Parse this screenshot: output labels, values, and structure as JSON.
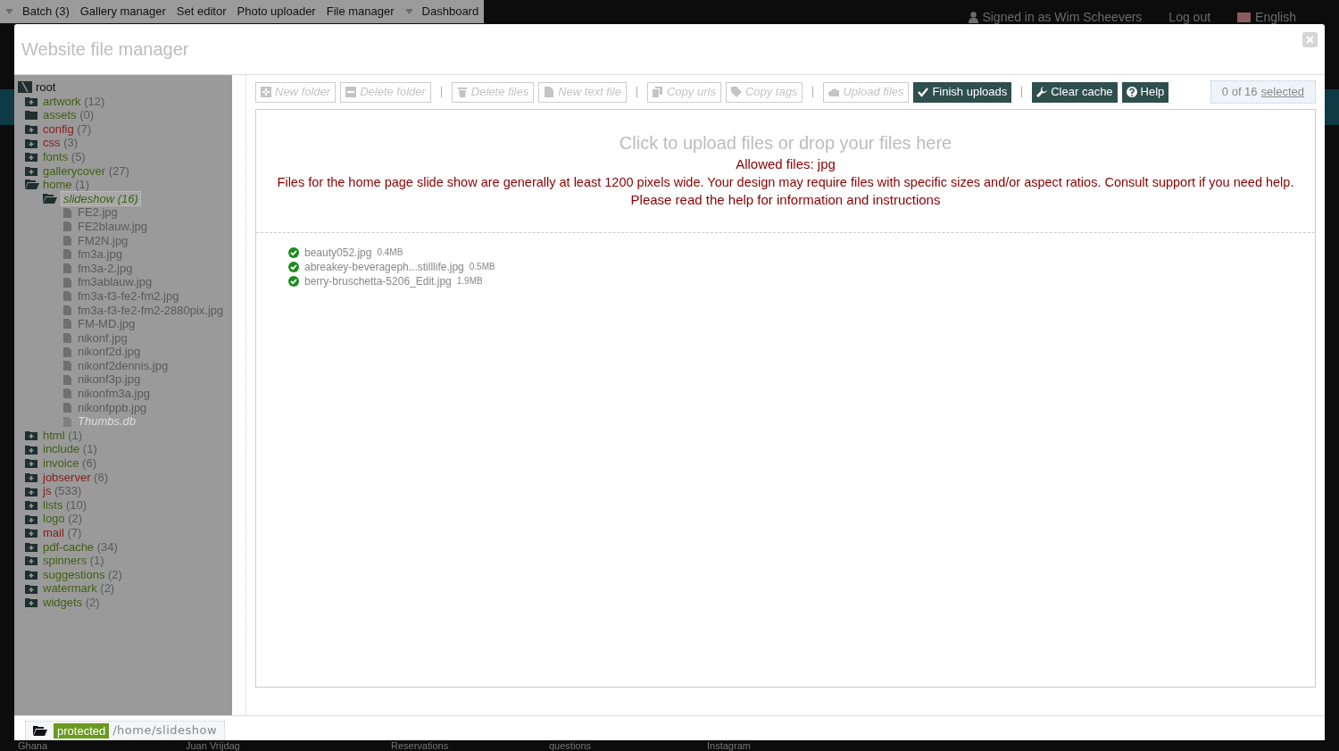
{
  "top_menu": [
    {
      "label": "Batch (3)",
      "caret": true
    },
    {
      "label": "Gallery manager",
      "caret": false
    },
    {
      "label": "Set editor",
      "caret": false
    },
    {
      "label": "Photo uploader",
      "caret": false
    },
    {
      "label": "File manager",
      "caret": false
    },
    {
      "label": "Dashboard",
      "caret": true
    }
  ],
  "user_bar": {
    "signed_in": "Signed in as Wim Scheevers",
    "logout": "Log out",
    "language": "English"
  },
  "window": {
    "title": "Website file manager"
  },
  "tree": {
    "root": "root",
    "children": [
      {
        "kind": "folder",
        "name": "artwork",
        "count": "(12)",
        "color": "#3f5f12",
        "expanded": false,
        "selected": false
      },
      {
        "kind": "folder",
        "name": "assets",
        "count": "(0)",
        "color": "#3f5f12",
        "expanded": false,
        "selected": false,
        "empty": true
      },
      {
        "kind": "folder",
        "name": "config",
        "count": "(7)",
        "color": "#8b1a1a",
        "expanded": false,
        "selected": false
      },
      {
        "kind": "folder",
        "name": "css",
        "count": "(3)",
        "color": "#8b1a1a",
        "expanded": false,
        "selected": false
      },
      {
        "kind": "folder",
        "name": "fonts",
        "count": "(5)",
        "color": "#3f5f12",
        "expanded": false,
        "selected": false
      },
      {
        "kind": "folder",
        "name": "gallerycover",
        "count": "(27)",
        "color": "#3f5f12",
        "expanded": false,
        "selected": false
      },
      {
        "kind": "folder",
        "name": "home",
        "count": "(1)",
        "color": "#3f5f12",
        "expanded": true,
        "selected": false,
        "children": [
          {
            "kind": "folder",
            "name": "slideshow",
            "count": "(16)",
            "color": "#3f5f12",
            "expanded": true,
            "selected": true,
            "children": [
              {
                "kind": "file",
                "name": "FE2.jpg",
                "hidden": false
              },
              {
                "kind": "file",
                "name": "FE2blauw.jpg",
                "hidden": false
              },
              {
                "kind": "file",
                "name": "FM2N.jpg",
                "hidden": false
              },
              {
                "kind": "file",
                "name": "fm3a.jpg",
                "hidden": false
              },
              {
                "kind": "file",
                "name": "fm3a-2.jpg",
                "hidden": false
              },
              {
                "kind": "file",
                "name": "fm3ablauw.jpg",
                "hidden": false
              },
              {
                "kind": "file",
                "name": "fm3a-f3-fe2-fm2.jpg",
                "hidden": false
              },
              {
                "kind": "file",
                "name": "fm3a-f3-fe2-fm2-2880pix.jpg",
                "hidden": false
              },
              {
                "kind": "file",
                "name": "FM-MD.jpg",
                "hidden": false
              },
              {
                "kind": "file",
                "name": "nikonf.jpg",
                "hidden": false
              },
              {
                "kind": "file",
                "name": "nikonf2d.jpg",
                "hidden": false
              },
              {
                "kind": "file",
                "name": "nikonf2dennis.jpg",
                "hidden": false
              },
              {
                "kind": "file",
                "name": "nikonf3p.jpg",
                "hidden": false
              },
              {
                "kind": "file",
                "name": "nikonfm3a.jpg",
                "hidden": false
              },
              {
                "kind": "file",
                "name": "nikonfppb.jpg",
                "hidden": false
              },
              {
                "kind": "file",
                "name": "Thumbs.db",
                "hidden": true
              }
            ]
          }
        ]
      },
      {
        "kind": "folder",
        "name": "html",
        "count": "(1)",
        "color": "#3f5f12",
        "expanded": false,
        "selected": false
      },
      {
        "kind": "folder",
        "name": "include",
        "count": "(1)",
        "color": "#3f5f12",
        "expanded": false,
        "selected": false
      },
      {
        "kind": "folder",
        "name": "invoice",
        "count": "(6)",
        "color": "#3f5f12",
        "expanded": false,
        "selected": false
      },
      {
        "kind": "folder",
        "name": "jobserver",
        "count": "(6)",
        "color": "#8b1a1a",
        "expanded": false,
        "selected": false
      },
      {
        "kind": "folder",
        "name": "js",
        "count": "(533)",
        "color": "#8b1a1a",
        "expanded": false,
        "selected": false
      },
      {
        "kind": "folder",
        "name": "lists",
        "count": "(10)",
        "color": "#3f5f12",
        "expanded": false,
        "selected": false
      },
      {
        "kind": "folder",
        "name": "logo",
        "count": "(2)",
        "color": "#3f5f12",
        "expanded": false,
        "selected": false
      },
      {
        "kind": "folder",
        "name": "mail",
        "count": "(7)",
        "color": "#8b1a1a",
        "expanded": false,
        "selected": false
      },
      {
        "kind": "folder",
        "name": "pdf-cache",
        "count": "(34)",
        "color": "#3f5f12",
        "expanded": false,
        "selected": false
      },
      {
        "kind": "folder",
        "name": "spinners",
        "count": "(1)",
        "color": "#3f5f12",
        "expanded": false,
        "selected": false
      },
      {
        "kind": "folder",
        "name": "suggestions",
        "count": "(2)",
        "color": "#3f5f12",
        "expanded": false,
        "selected": false
      },
      {
        "kind": "folder",
        "name": "watermark",
        "count": "(2)",
        "color": "#3f5f12",
        "expanded": false,
        "selected": false
      },
      {
        "kind": "folder",
        "name": "widgets",
        "count": "(2)",
        "color": "#3f5f12",
        "expanded": false,
        "selected": false
      }
    ]
  },
  "toolbar": [
    {
      "kind": "button",
      "label": "New folder",
      "disabled": true
    },
    {
      "kind": "button",
      "label": "Delete folder",
      "disabled": true
    },
    {
      "kind": "separator"
    },
    {
      "kind": "button",
      "label": "Delete files",
      "disabled": true
    },
    {
      "kind": "button",
      "label": "New text file",
      "disabled": true
    },
    {
      "kind": "separator"
    },
    {
      "kind": "button",
      "label": "Copy urls",
      "disabled": true
    },
    {
      "kind": "button",
      "label": "Copy tags",
      "disabled": true
    },
    {
      "kind": "separator"
    },
    {
      "kind": "button",
      "label": "Upload files",
      "disabled": true
    },
    {
      "kind": "button",
      "label": "Finish uploads",
      "disabled": false
    },
    {
      "kind": "separator"
    },
    {
      "kind": "button",
      "label": "Clear cache",
      "disabled": false
    },
    {
      "kind": "button",
      "label": "Help",
      "disabled": false
    }
  ],
  "selection": {
    "count": "0 of 16",
    "link": "selected"
  },
  "dropzone": {
    "prompt": "Click to upload files or drop your files here",
    "allowed": "Allowed files: jpg",
    "note": "Files for the home page slide show are generally at least 1200 pixels wide. Your design may require files with specific sizes and/or aspect ratios. Consult support if you need help.",
    "help": "Please read the help for information and instructions"
  },
  "uploads": [
    {
      "name": "beauty052.jpg",
      "size": "0.4MB",
      "done": true
    },
    {
      "name": "abreakey-beverageph...stilllife.jpg",
      "size": "0.5MB",
      "done": true
    },
    {
      "name": "berry-bruschetta-5206_Edit.jpg",
      "size": "1.9MB",
      "done": true
    }
  ],
  "footer": {
    "badge": "protected",
    "path": "/home/slideshow"
  },
  "background_links": [
    "Ghana",
    "Juan Vrijdag",
    "Reservations",
    "questions",
    "Instagram"
  ]
}
